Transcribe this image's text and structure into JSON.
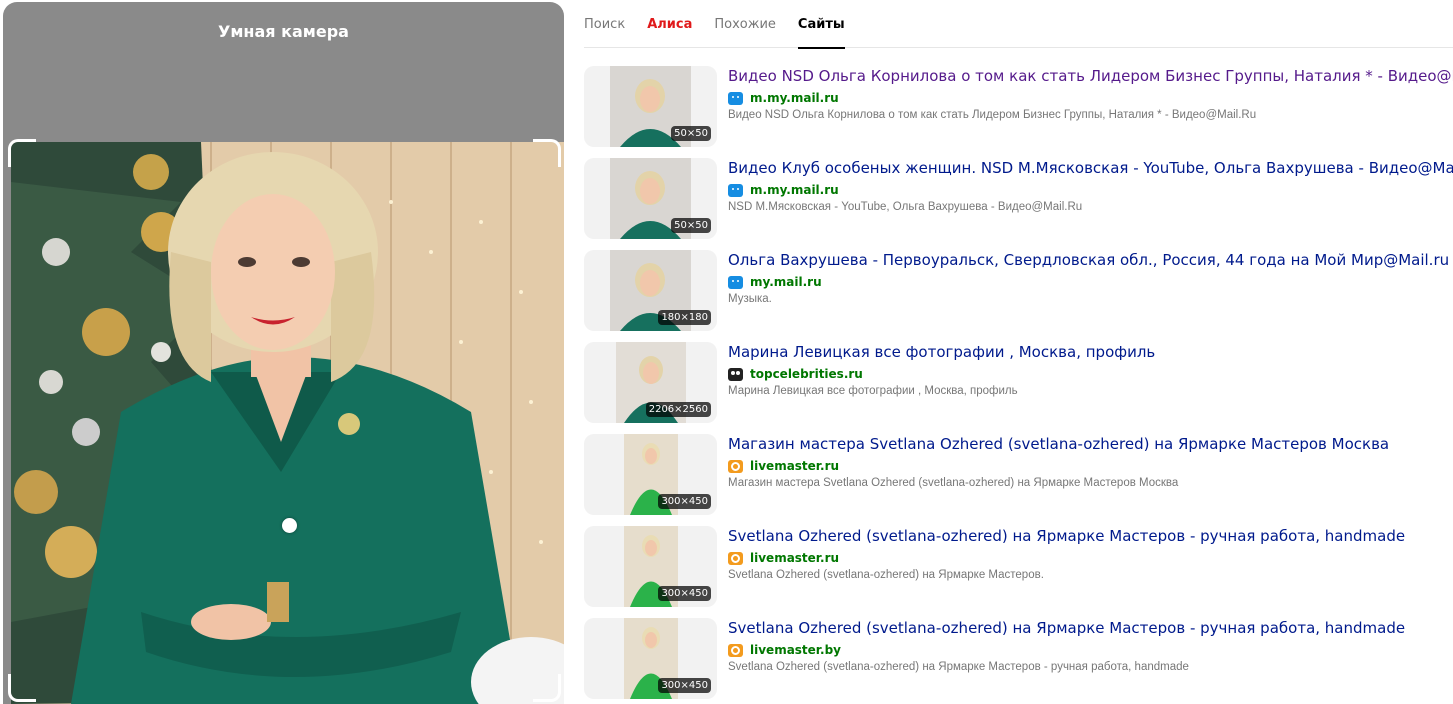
{
  "left": {
    "title": "Умная камера"
  },
  "tabs": [
    {
      "label": "Поиск"
    },
    {
      "label": "Алиса"
    },
    {
      "label": "Похожие"
    },
    {
      "label": "Сайты"
    }
  ],
  "results": [
    {
      "title": "Видео NSD Ольга Корнилова о том как стать Лидером Бизнес Группы, Наталия * - Видео@Mail.Ru",
      "site": "m.my.mail.ru",
      "snippet": "Видео NSD Ольга Корнилова о том как стать Лидером Бизнес Группы, Наталия * - Видео@Mail.Ru",
      "size": "50×50",
      "favicon": "mail-icon"
    },
    {
      "title": "Видео Клуб особеных женщин. NSD М.Мясковская - YouTube, Ольга Вахрушева - Видео@Mail.Ru",
      "site": "m.my.mail.ru",
      "snippet": "NSD М.Мясковская - YouTube, Ольга Вахрушева - Видео@Mail.Ru",
      "size": "50×50",
      "favicon": "mail-icon"
    },
    {
      "title": "Ольга Вахрушева - Первоуральск, Свердловская обл., Россия, 44 года на Мой Мир@Mail.ru",
      "site": "my.mail.ru",
      "snippet": "Музыка.",
      "size": "180×180",
      "favicon": "mail-icon"
    },
    {
      "title": "Марина Левицкая все фотографии , Москва, профиль",
      "site": "topcelebrities.ru",
      "snippet": "Марина Левицкая все фотографии , Москва, профиль",
      "size": "2206×2560",
      "favicon": "topcelebrities-icon"
    },
    {
      "title": "Магазин мастера Svetlana Ozhered (svetlana-ozhered) на Ярмарке Мастеров Москва",
      "site": "livemaster.ru",
      "snippet": "Магазин мастера Svetlana Ozhered (svetlana-ozhered) на Ярмарке Мастеров Москва",
      "size": "300×450",
      "favicon": "livemaster-icon"
    },
    {
      "title": "Svetlana Ozhered (svetlana-ozhered) на Ярмарке Мастеров - ручная работа, handmade",
      "site": "livemaster.ru",
      "snippet": "Svetlana Ozhered (svetlana-ozhered) на Ярмарке Мастеров.",
      "size": "300×450",
      "favicon": "livemaster-icon"
    },
    {
      "title": "Svetlana Ozhered (svetlana-ozhered) на Ярмарке Мастеров - ручная работа, handmade",
      "site": "livemaster.by",
      "snippet": "Svetlana Ozhered (svetlana-ozhered) на Ярмарке Мастеров - ручная работа, handmade",
      "size": "300×450",
      "favicon": "livemaster-icon"
    }
  ]
}
